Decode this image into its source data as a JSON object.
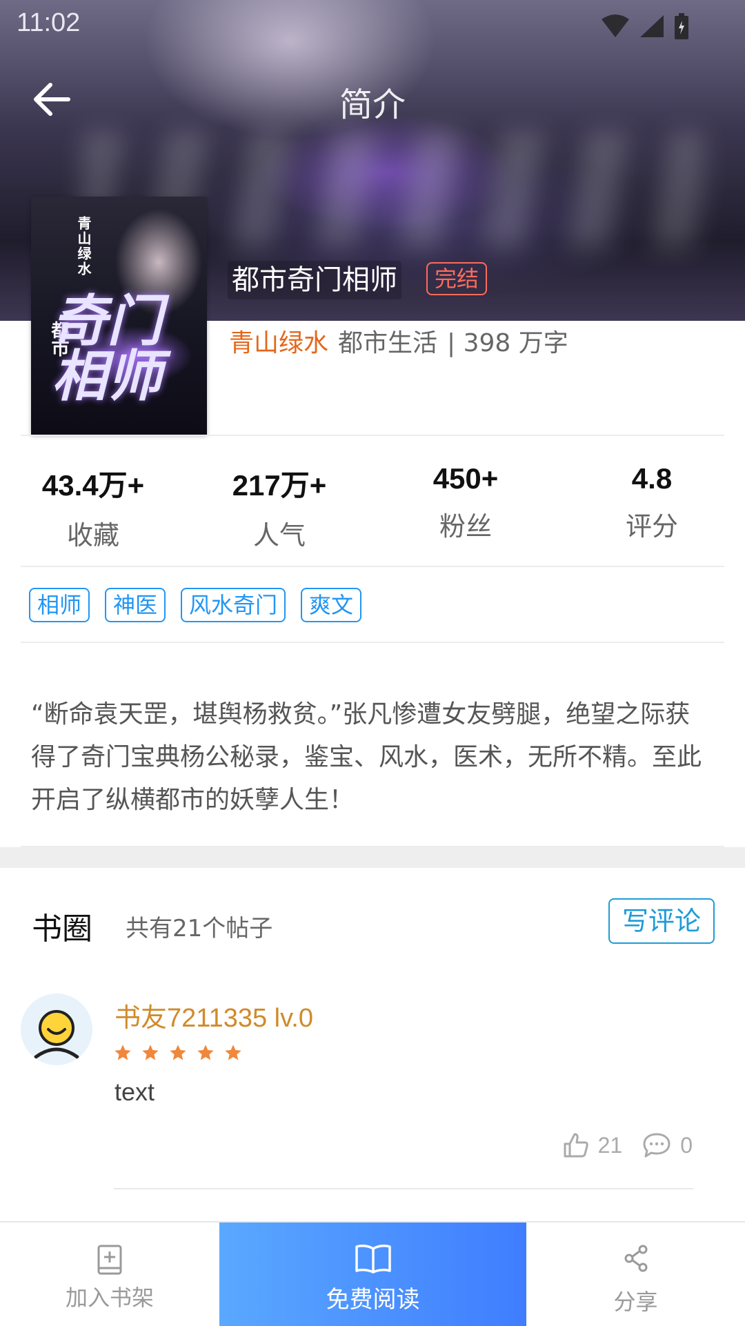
{
  "status_bar": {
    "time": "11:02"
  },
  "header": {
    "title": "简介"
  },
  "cover": {
    "author_text": "青山绿水",
    "title_text": "奇门\n相师",
    "genre_text": "都市"
  },
  "book": {
    "title": "都市奇门相师",
    "status": "完结",
    "author": "青山绿水",
    "category": "都市生活",
    "word_count": "| 398 万字"
  },
  "stats": [
    {
      "value": "43.4万+",
      "label": "收藏"
    },
    {
      "value": "217万+",
      "label": "人气"
    },
    {
      "value": "450+",
      "label": "粉丝"
    },
    {
      "value": "4.8",
      "label": "评分"
    }
  ],
  "tags": [
    "相师",
    "神医",
    "风水奇门",
    "爽文"
  ],
  "intro": "“断命袁天罡，堪舆杨救贫。”张凡惨遭女友劈腿，绝望之际获得了奇门宝典杨公秘录，鉴宝、风水，医术，无所不精。至此开启了纵横都市的妖孽人生！",
  "circle": {
    "title": "书圈",
    "count": "共有21个帖子",
    "write_label": "写评论"
  },
  "post": {
    "user": "书友7211335 lv.0",
    "rating": 5,
    "text": "text",
    "likes": "21",
    "comments": "0"
  },
  "bottom_bar": {
    "shelf_label": "加入书架",
    "read_label": "免费阅读",
    "share_label": "分享"
  },
  "colors": {
    "accent_blue": "#2196f3",
    "author_orange": "#e2681e",
    "badge_red": "#ff6b5a",
    "star_orange": "#f0873a",
    "read_gradient_start": "#5aa8ff",
    "read_gradient_end": "#3f7dff"
  }
}
